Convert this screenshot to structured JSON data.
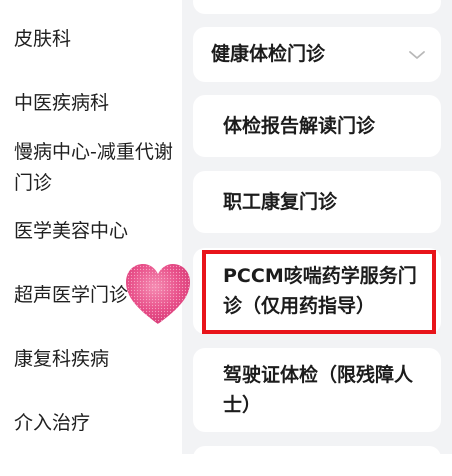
{
  "departments": [
    "皮肤科",
    "中医疾病科",
    "慢病中心-减重代谢门诊",
    "医学美容中心",
    "超声医学门诊",
    "康复科疾病",
    "介入治疗"
  ],
  "clinics": {
    "group_label": "健康体检门诊",
    "items": [
      "体检报告解读门诊",
      "职工康复门诊",
      "PCCM咳喘药学服务门诊（仅用药指导）",
      "驾驶证体检（限残障人士）"
    ]
  },
  "colors": {
    "highlight": "#e8141a",
    "sticker": "#e8508a",
    "panel_bg": "#f2f3f5"
  },
  "icons": [
    "chevron-down-icon",
    "heart-sticker"
  ]
}
